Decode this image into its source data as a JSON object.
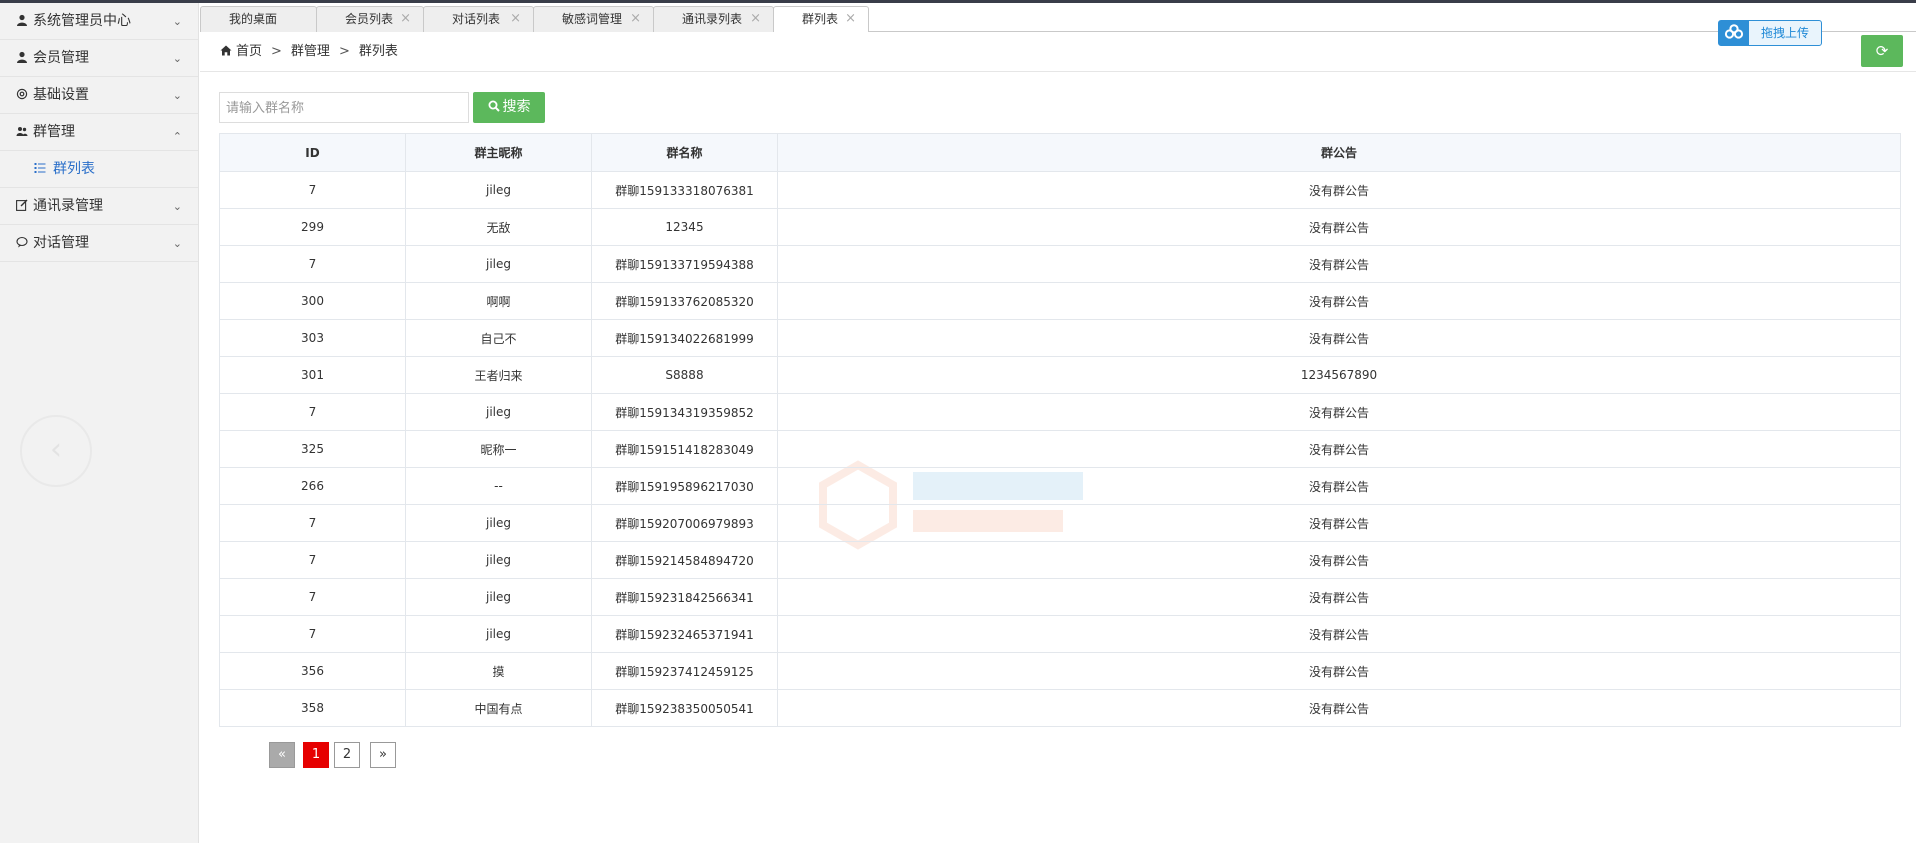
{
  "sidebar": {
    "items": [
      {
        "label": "系统管理员中心",
        "icon": "user-icon",
        "expanded": false
      },
      {
        "label": "会员管理",
        "icon": "user-icon",
        "expanded": false
      },
      {
        "label": "基础设置",
        "icon": "gear-icon",
        "expanded": false
      },
      {
        "label": "群管理",
        "icon": "users-icon",
        "expanded": true
      },
      {
        "label": "通讯录管理",
        "icon": "edit-icon",
        "expanded": false
      },
      {
        "label": "对话管理",
        "icon": "chat-icon",
        "expanded": false
      }
    ],
    "sub_items": [
      {
        "label": "群列表",
        "icon": "list-icon"
      }
    ]
  },
  "tabs": [
    {
      "label": "我的桌面",
      "closable": false
    },
    {
      "label": "会员列表",
      "closable": true
    },
    {
      "label": "对话列表",
      "closable": true
    },
    {
      "label": "敏感词管理",
      "closable": true
    },
    {
      "label": "通讯录列表",
      "closable": true
    },
    {
      "label": "群列表",
      "closable": true,
      "active": true
    }
  ],
  "breadcrumb": {
    "home": "首页",
    "level1": "群管理",
    "level2": "群列表",
    "separator": ">"
  },
  "upload": {
    "label": "拖拽上传"
  },
  "search": {
    "placeholder": "请输入群名称",
    "value": "",
    "button_label": "搜索"
  },
  "table": {
    "headers": [
      "ID",
      "群主昵称",
      "群名称",
      "群公告"
    ],
    "rows": [
      [
        "7",
        "jileg",
        "群聊159133318076381",
        "没有群公告"
      ],
      [
        "299",
        "无敌",
        "12345",
        "没有群公告"
      ],
      [
        "7",
        "jileg",
        "群聊159133719594388",
        "没有群公告"
      ],
      [
        "300",
        "啊啊",
        "群聊159133762085320",
        "没有群公告"
      ],
      [
        "303",
        "自己不",
        "群聊159134022681999",
        "没有群公告"
      ],
      [
        "301",
        "王者归来",
        "S8888",
        "1234567890"
      ],
      [
        "7",
        "jileg",
        "群聊159134319359852",
        "没有群公告"
      ],
      [
        "325",
        "昵称一",
        "群聊159151418283049",
        "没有群公告"
      ],
      [
        "266",
        "--",
        "群聊159195896217030",
        "没有群公告"
      ],
      [
        "7",
        "jileg",
        "群聊159207006979893",
        "没有群公告"
      ],
      [
        "7",
        "jileg",
        "群聊159214584894720",
        "没有群公告"
      ],
      [
        "7",
        "jileg",
        "群聊159231842566341",
        "没有群公告"
      ],
      [
        "7",
        "jileg",
        "群聊159232465371941",
        "没有群公告"
      ],
      [
        "356",
        "摸",
        "群聊159237412459125",
        "没有群公告"
      ],
      [
        "358",
        "中国有点",
        "群聊159238350050541",
        "没有群公告"
      ]
    ]
  },
  "pagination": {
    "prev": "«",
    "pages": [
      "1",
      "2"
    ],
    "current": "1",
    "next": "»"
  },
  "colors": {
    "accent_green": "#5cb85c",
    "active_page_red": "#e60000",
    "link_blue": "#2a6fc9"
  }
}
